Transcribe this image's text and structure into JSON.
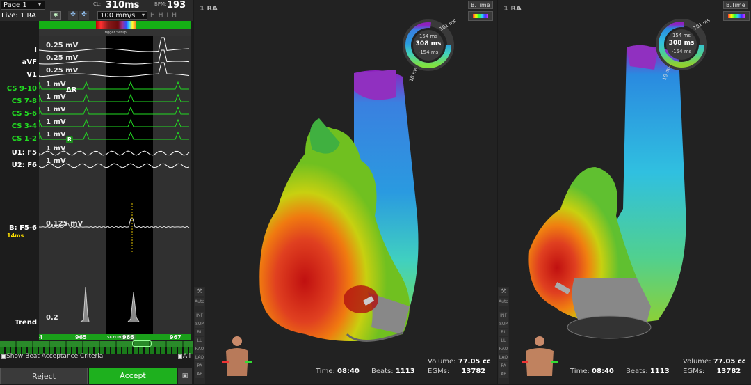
{
  "toolbar": {
    "page": "Page 1",
    "live": "Live: 1 RA",
    "cl_label": "CL:",
    "cl_value": "310ms",
    "bpm_label": "BPM:",
    "bpm_value": "193",
    "speed": "100 mm/s",
    "trigger": "Trigger Setup"
  },
  "channels": [
    {
      "name": "I",
      "gain": "0.25 mV",
      "color": "#ffffff"
    },
    {
      "name": "aVF",
      "gain": "0.25 mV",
      "color": "#ffffff"
    },
    {
      "name": "V1",
      "gain": "0.25 mV",
      "color": "#ffffff"
    },
    {
      "name": "CS 9-10",
      "gain": "1 mV",
      "color": "#22dd22"
    },
    {
      "name": "CS 7-8",
      "gain": "1 mV",
      "color": "#22dd22"
    },
    {
      "name": "CS 5-6",
      "gain": "1 mV",
      "color": "#22dd22"
    },
    {
      "name": "CS 3-4",
      "gain": "1 mV",
      "color": "#22dd22"
    },
    {
      "name": "CS 1-2",
      "gain": "1 mV",
      "color": "#22dd22"
    },
    {
      "name": "U1: F5",
      "gain": "1 mV",
      "color": "#ffffff"
    },
    {
      "name": "U2: F6",
      "gain": "1 mV",
      "color": "#ffffff"
    }
  ],
  "bipolar": {
    "name": "B: F5-6",
    "gain": "0.125 mV",
    "delay": "14ms"
  },
  "trend": {
    "name": "Trend",
    "gain": "0.2"
  },
  "markers": {
    "dr": "ΔR",
    "r": "R",
    "left": "4",
    "b1": "965",
    "b2": "966",
    "b3": "967",
    "skyline": "SKYLINE"
  },
  "footer": {
    "beat_criteria": "Show Beat Acceptance Criteria",
    "all": "All",
    "reject": "Reject",
    "accept": "Accept"
  },
  "maps": [
    {
      "title": "1 RA",
      "mode": "B.Time",
      "time_label": "Time:",
      "time": "08:40",
      "beats_label": "Beats:",
      "beats": "1113",
      "volume_label": "Volume:",
      "volume": "77.05 cc",
      "egms_label": "EGMs:",
      "egms": "13782",
      "ring_top": "154 ms",
      "ring_mid": "308 ms",
      "ring_bot": "-154 ms",
      "ring_r1": "101 ms",
      "ring_r2": "18 ms"
    },
    {
      "title": "1 RA",
      "mode": "B.Time",
      "time_label": "Time:",
      "time": "08:40",
      "beats_label": "Beats:",
      "beats": "1113",
      "volume_label": "Volume:",
      "volume": "77.05 cc",
      "egms_label": "EGMs:",
      "egms": "13782",
      "ring_top": "154 ms",
      "ring_mid": "308 ms",
      "ring_bot": "-154 ms",
      "ring_r1": "101 ms",
      "ring_r2": "18 ms"
    }
  ],
  "view_buttons": [
    "Auto",
    "INF",
    "SUP",
    "RL",
    "LL",
    "RAO",
    "LAO",
    "PA",
    "AP"
  ]
}
